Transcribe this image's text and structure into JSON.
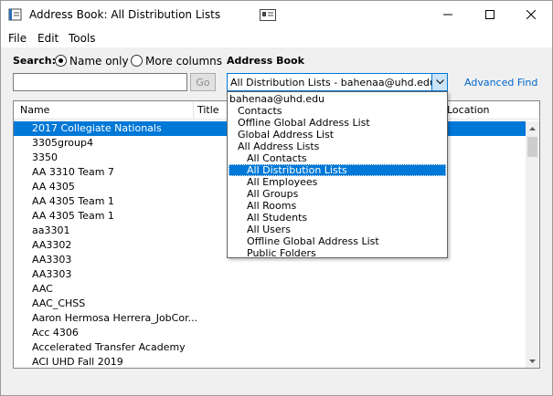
{
  "window": {
    "title": "Address Book: All Distribution Lists"
  },
  "menu": [
    "File",
    "Edit",
    "Tools"
  ],
  "search": {
    "label": "Search:",
    "name_only": "Name only",
    "more_columns": "More columns",
    "input_value": "",
    "go_label": "Go"
  },
  "address_book": {
    "label": "Address Book",
    "selected": "All Distribution Lists - bahenaa@uhd.edu",
    "advanced_find": "Advanced Find"
  },
  "columns": [
    "Name",
    "Title",
    "Location"
  ],
  "rows": [
    "2017 Collegiate Nationals",
    "3305group4",
    "3350",
    "AA 3310 Team 7",
    "AA 4305",
    "AA 4305 Team 1",
    "AA 4305 Team 1",
    "aa3301",
    "AA3302",
    "AA3303",
    "AA3303",
    "AAC",
    "AAC_CHSS",
    "Aaron Hermosa Herrera_JobCor...",
    "Acc 4306",
    "Accelerated Transfer Academy",
    "ACI UHD Fall 2019"
  ],
  "dropdown": [
    "bahenaa@uhd.edu",
    "Contacts",
    "Offline Global Address List",
    "Global Address List",
    "All Address Lists",
    "All Contacts",
    "All Distribution Lists",
    "All Employees",
    "All Groups",
    "All Rooms",
    "All Students",
    "All Users",
    "Offline Global Address List",
    "Public Folders"
  ],
  "colors": {
    "accent": "#0078d7",
    "link": "#0066cc"
  }
}
